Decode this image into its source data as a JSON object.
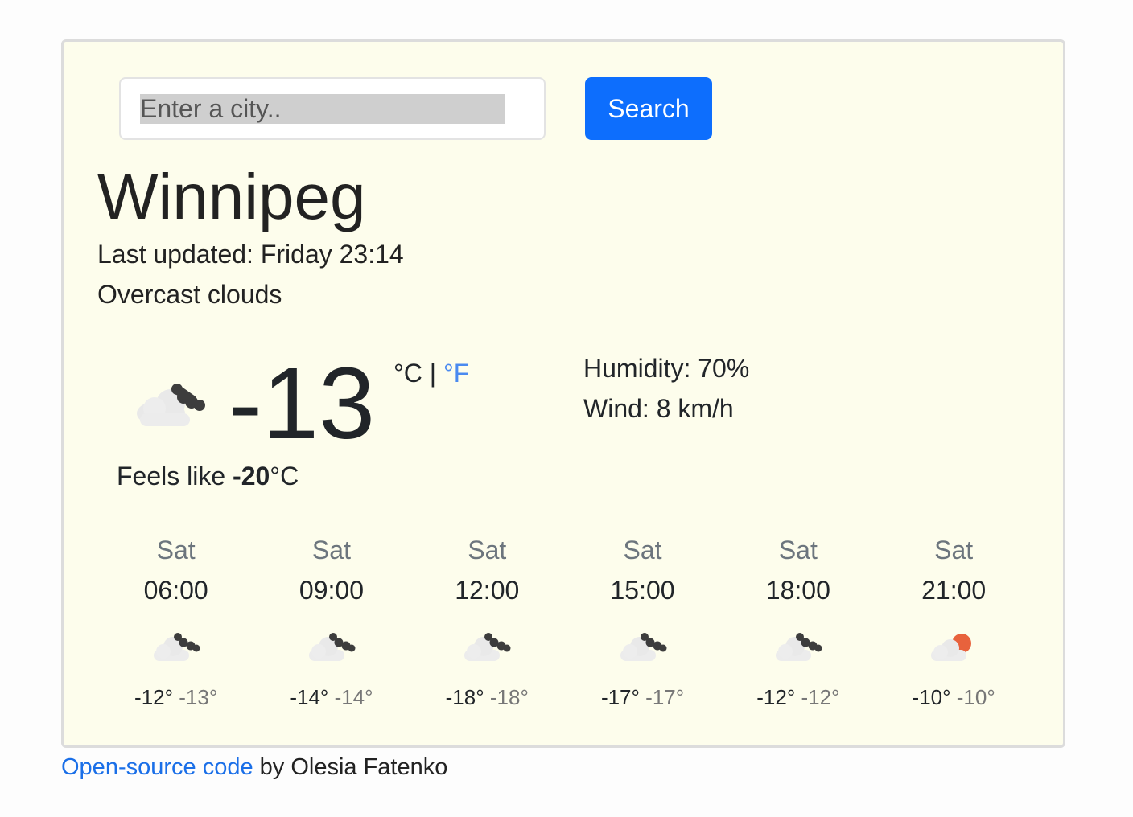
{
  "search": {
    "placeholder": "Enter a city..",
    "button_label": "Search"
  },
  "current": {
    "city": "Winnipeg",
    "last_updated_label": "Last updated:",
    "last_updated_value": "Friday 23:14",
    "description": "Overcast clouds",
    "icon": "broken-clouds-icon",
    "temperature": "-13",
    "unit_celsius": "°C",
    "unit_separator": "|",
    "unit_fahrenheit": "°F",
    "feels_like_label": "Feels like",
    "feels_like_value": "-20",
    "feels_like_unit": "°C",
    "humidity": "Humidity: 70%",
    "wind": "Wind: 8 km/h"
  },
  "forecast": [
    {
      "day": "Sat",
      "time": "06:00",
      "icon": "broken-clouds-icon",
      "max": "-12°",
      "min": "-13°"
    },
    {
      "day": "Sat",
      "time": "09:00",
      "icon": "broken-clouds-icon",
      "max": "-14°",
      "min": "-14°"
    },
    {
      "day": "Sat",
      "time": "12:00",
      "icon": "broken-clouds-icon",
      "max": "-18°",
      "min": "-18°"
    },
    {
      "day": "Sat",
      "time": "15:00",
      "icon": "broken-clouds-icon",
      "max": "-17°",
      "min": "-17°"
    },
    {
      "day": "Sat",
      "time": "18:00",
      "icon": "broken-clouds-icon",
      "max": "-12°",
      "min": "-12°"
    },
    {
      "day": "Sat",
      "time": "21:00",
      "icon": "few-clouds-night-icon",
      "max": "-10°",
      "min": "-10°"
    }
  ],
  "footer": {
    "link_text": "Open-source code",
    "suffix": " by Olesia Fatenko"
  },
  "colors": {
    "card_background": "#fdfdec",
    "primary_button": "#0d6efd",
    "link": "#1a6fe8",
    "moon_accent": "#e8623c"
  }
}
